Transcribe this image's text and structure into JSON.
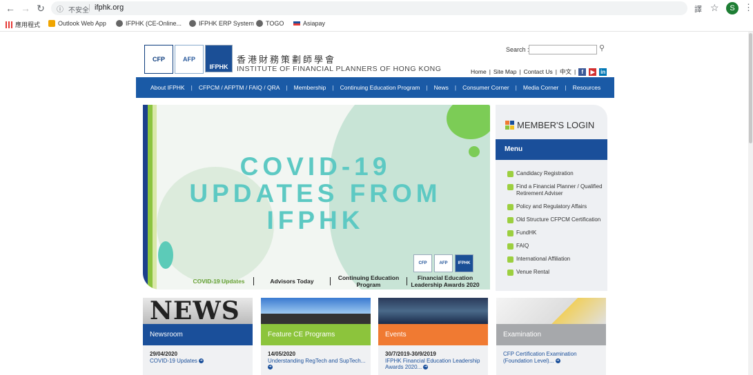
{
  "browser": {
    "insecure_label": "不安全",
    "url": "ifphk.org",
    "avatar_letter": "S",
    "bookmarks": [
      "應用程式",
      "Outlook Web App",
      "IFPHK (CE-Online...",
      "IFPHK ERP System",
      "TOGO",
      "Asiapay"
    ]
  },
  "header": {
    "logo_cfp": "CFP",
    "logo_afp": "AFP",
    "logo_ifphk": "IFPHK",
    "org_cn": "香港財務策劃師學會",
    "org_en": "INSTITUTE OF FINANCIAL PLANNERS OF HONG KONG",
    "search_label": "Search :",
    "toplinks": [
      "Home",
      "Site Map",
      "Contact Us",
      "中文"
    ]
  },
  "nav": {
    "items": [
      "About IFPHK",
      "CFPCM / AFPTM / FAIQ / QRA",
      "Membership",
      "Continuing Education Program",
      "News",
      "Consumer Corner",
      "Media Corner",
      "Resources"
    ]
  },
  "hero": {
    "line1": "COVID-19",
    "line2": "UPDATES FROM",
    "line3": "IFPHK",
    "tabs": [
      "COVID-19 Updates",
      "Advisors Today",
      "Continuing Education Program",
      "Financial Education Leadership Awards 2020"
    ]
  },
  "login": {
    "title": "MEMBER'S LOGIN",
    "menu_label": "Menu",
    "items": [
      "Candidacy Registration",
      "Find a Financial Planner / Qualified Retirement Adviser",
      "Policy and Regulatory Affairs",
      "Old Structure CFPCM Certification",
      "FundHK",
      "FAIQ",
      "International Affiliation",
      "Venue Rental"
    ]
  },
  "cards": [
    {
      "title": "Newsroom",
      "date": "29/04/2020",
      "text": "COVID-19 Updates",
      "img_text": "NEWS",
      "color": "#1a4f9a"
    },
    {
      "title": "Feature CE Programs",
      "date": "14/05/2020",
      "text": "Understanding RegTech and SupTech...",
      "img_text": "",
      "color": "#8cc43c"
    },
    {
      "title": "Events",
      "date": "30/7/2019-30/9/2019",
      "text": "IFPHK Financial Education Leadership Awards 2020...",
      "img_text": "",
      "color": "#f07a32"
    },
    {
      "title": "Examination",
      "date": "",
      "text": "CFP Certification Examination (Foundation Level)...",
      "img_text": "",
      "color": "#a6a8ab"
    }
  ]
}
